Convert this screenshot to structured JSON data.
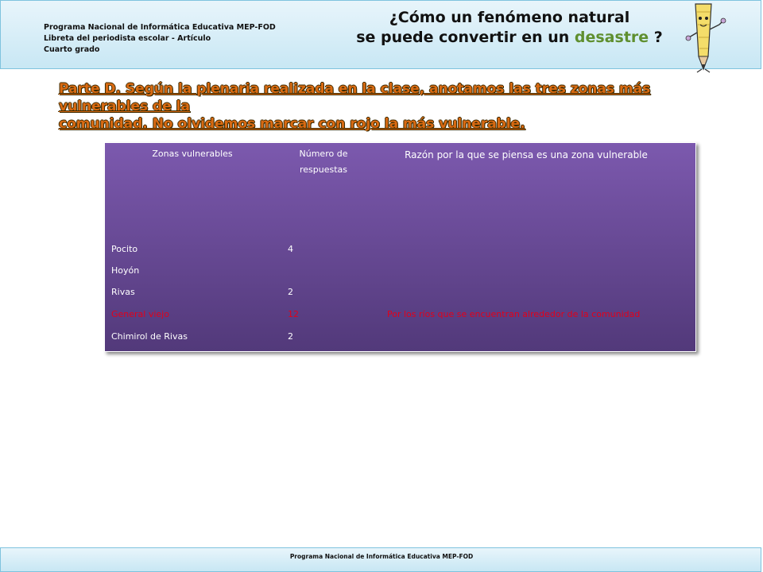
{
  "header": {
    "line1": "Programa Nacional de Informática Educativa MEP-FOD",
    "line2": "Libreta del periodista escolar - Artículo",
    "line3": "Cuarto grado",
    "title_line1": "¿Cómo un fenómeno natural",
    "title_line2_prefix": "se puede convertir en un ",
    "title_line2_highlight": "desastre",
    "title_line2_suffix": " ?"
  },
  "part_heading": {
    "line1": "Parte D. Según la plenaria realizada en la clase, anotamos las tres zonas más vulnerables de la",
    "line2": "comunidad. No olvidemos marcar con rojo la  más vulnerable."
  },
  "table": {
    "columns": [
      "Zonas vulnerables",
      "Número de respuestas",
      "Razón por la que se piensa es una zona vulnerable"
    ],
    "rows": [
      {
        "zone": "Pocito",
        "count": "4",
        "reason": "",
        "highlight": false
      },
      {
        "zone": "Hoyón",
        "count": "",
        "reason": "",
        "highlight": false
      },
      {
        "zone": "Rivas",
        "count": "2",
        "reason": "",
        "highlight": false
      },
      {
        "zone": "General viejo",
        "count": "12",
        "reason": "Por los ríos que se encuentran alrededor de la comunidad",
        "highlight": true
      },
      {
        "zone": "Chimirol de Rivas",
        "count": "2",
        "reason": "",
        "highlight": false
      }
    ],
    "highlight_color": "#e2001a"
  },
  "footer": {
    "text": "Programa  Nacional de Informática  Educativa MEP-FOD"
  }
}
